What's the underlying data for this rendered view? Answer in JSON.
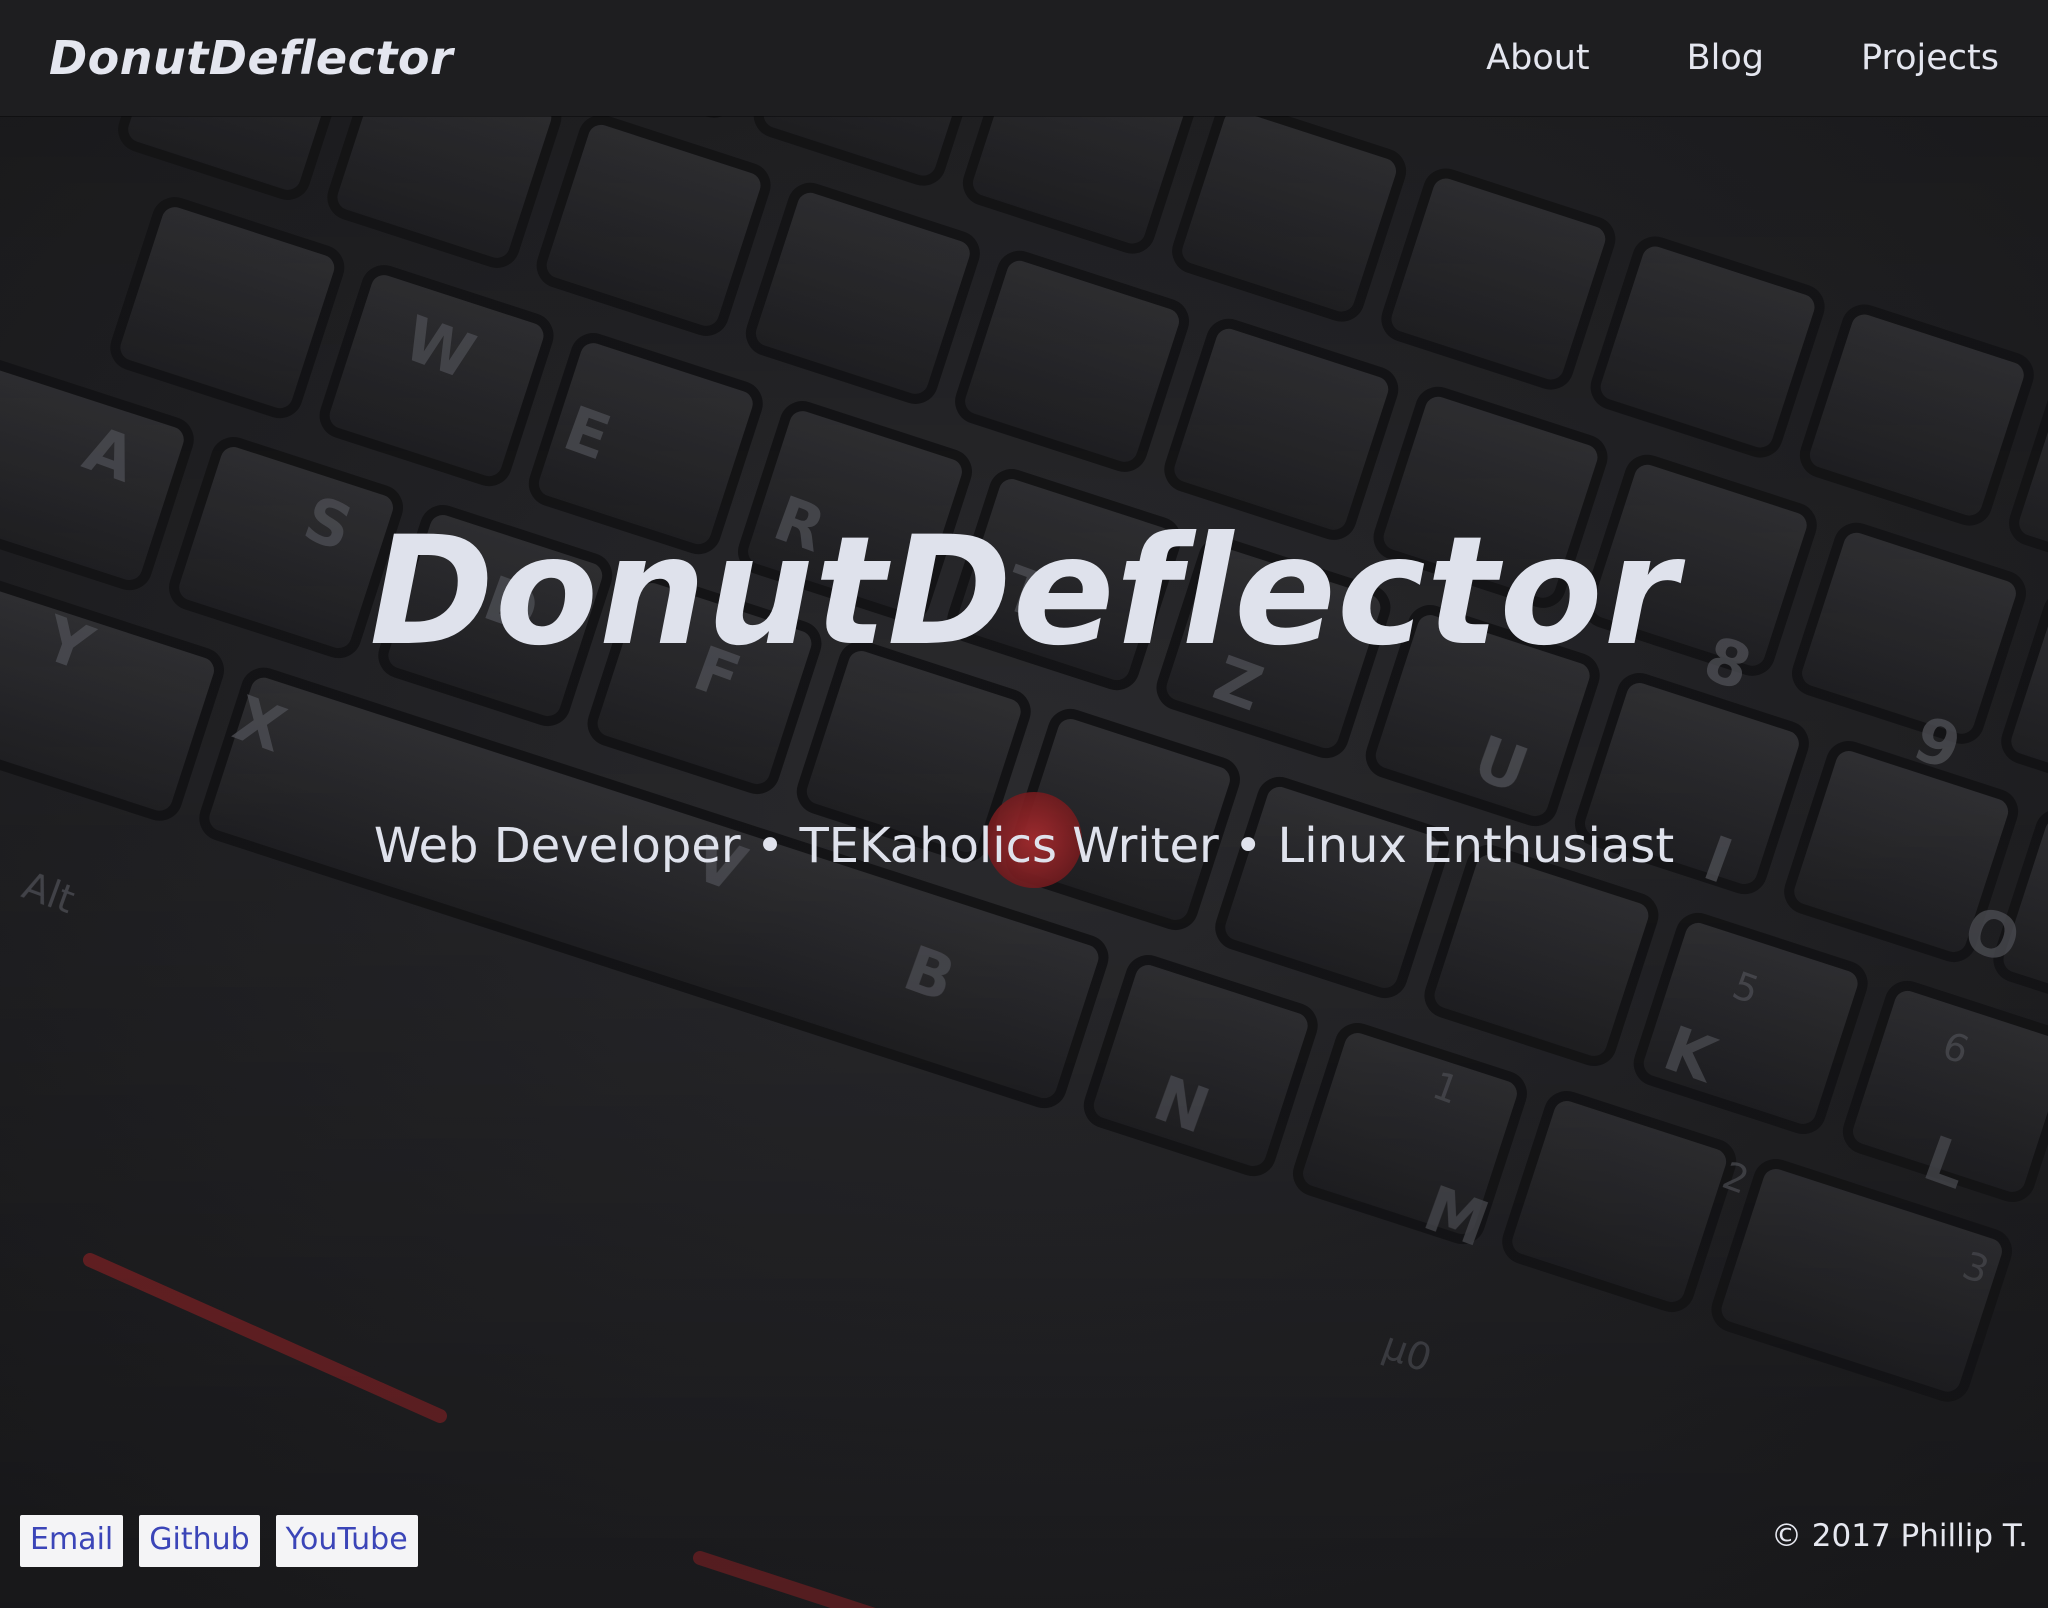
{
  "navbar": {
    "brand": "DonutDeflector",
    "links": [
      "About",
      "Blog",
      "Projects"
    ]
  },
  "hero": {
    "title": "DonutDeflector",
    "subtitle": "Web Developer • TEKaholics Writer • Linux Enthusiast",
    "background_image": "laptop-keyboard-photo"
  },
  "footer": {
    "links": [
      "Email",
      "Github",
      "YouTube"
    ],
    "copyright": "© 2017 Phillip T."
  },
  "colors": {
    "navbar_bg": "#1e1e20",
    "text": "#e4e6ef",
    "footer_link_bg": "#f4f4f6",
    "footer_link_text": "#3b45b8",
    "trackpoint_red": "#a3262a"
  }
}
